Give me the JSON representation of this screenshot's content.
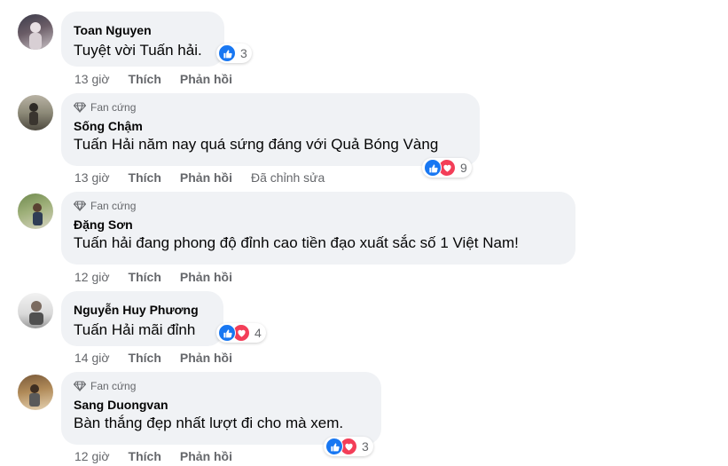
{
  "labels": {
    "like": "Thích",
    "reply": "Phản hồi",
    "badge": "Fan cứng",
    "edited": "Đã chỉnh sửa"
  },
  "comments": [
    {
      "author": "Toan Nguyen",
      "text": "Tuyệt vời Tuấn hải.",
      "time": "13 giờ",
      "reactions": [
        "like"
      ],
      "reaction_count": "3"
    },
    {
      "author": "Sống Chậm",
      "text": "Tuấn Hải năm nay quá sứng đáng với Quả Bóng Vàng",
      "time": "13 giờ",
      "badge": true,
      "edited": true,
      "reactions": [
        "like",
        "love"
      ],
      "reaction_count": "9"
    },
    {
      "author": "Đặng Sơn",
      "text": "Tuấn hải đang phong độ đỉnh cao tiền đạo xuất sắc số 1 Việt Nam!",
      "time": "12 giờ",
      "badge": true
    },
    {
      "author": "Nguyễn Huy Phương",
      "text": "Tuấn Hải mãi đỉnh",
      "time": "14 giờ",
      "reactions": [
        "like",
        "love"
      ],
      "reaction_count": "4"
    },
    {
      "author": "Sang Duongvan",
      "text": "Bàn thắng đẹp nhất lượt đi cho mà xem.",
      "time": "12 giờ",
      "badge": true,
      "reactions": [
        "like",
        "love"
      ],
      "reaction_count": "3"
    }
  ],
  "colors": {
    "bubble": "#f0f2f5",
    "like_blue": "#1877f2",
    "love_red": "#f33e58",
    "meta_gray": "#65676b"
  }
}
